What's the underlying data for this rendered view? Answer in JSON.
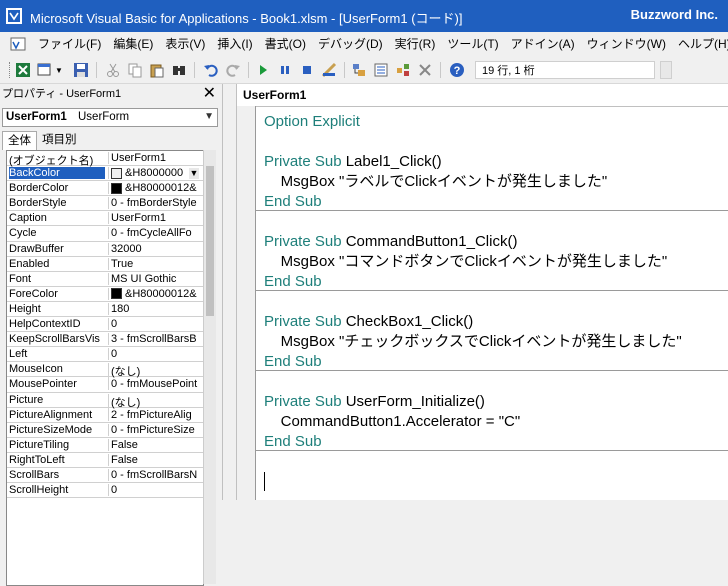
{
  "window": {
    "title": "Microsoft Visual Basic for Applications - Book1.xlsm - [UserForm1 (コード)]",
    "brand": "Buzzword Inc."
  },
  "menu": [
    "ファイル(F)",
    "編集(E)",
    "表示(V)",
    "挿入(I)",
    "書式(O)",
    "デバッグ(D)",
    "実行(R)",
    "ツール(T)",
    "アドイン(A)",
    "ウィンドウ(W)",
    "ヘルプ(H)"
  ],
  "toolbar": {
    "position": "19 行, 1 桁",
    "icons": [
      "excel-icon",
      "insert-userform-icon",
      "save-icon",
      "cut-icon",
      "copy-icon",
      "paste-icon",
      "find-icon",
      "undo-icon",
      "redo-icon",
      "run-icon",
      "break-icon",
      "reset-icon",
      "design-mode-icon",
      "project-explorer-icon",
      "properties-icon",
      "object-browser-icon",
      "toolbox-icon",
      "help-icon"
    ]
  },
  "properties": {
    "title": "プロパティ - UserForm1",
    "object_name": "UserForm1",
    "object_type": "UserForm",
    "tabs": [
      "全体",
      "項目別"
    ],
    "rows": [
      {
        "k": "(オブジェクト名)",
        "v": "UserForm1"
      },
      {
        "k": "BackColor",
        "v": "&H8000000",
        "swatch": "#f0f0f0",
        "selected": true,
        "dropdown": true
      },
      {
        "k": "BorderColor",
        "v": "&H80000012&",
        "swatch": "#000000"
      },
      {
        "k": "BorderStyle",
        "v": "0 - fmBorderStyle"
      },
      {
        "k": "Caption",
        "v": "UserForm1"
      },
      {
        "k": "Cycle",
        "v": "0 - fmCycleAllFo"
      },
      {
        "k": "DrawBuffer",
        "v": "32000"
      },
      {
        "k": "Enabled",
        "v": "True"
      },
      {
        "k": "Font",
        "v": "MS UI Gothic"
      },
      {
        "k": "ForeColor",
        "v": "&H80000012&",
        "swatch": "#000000"
      },
      {
        "k": "Height",
        "v": "180"
      },
      {
        "k": "HelpContextID",
        "v": "0"
      },
      {
        "k": "KeepScrollBarsVis",
        "v": "3 - fmScrollBarsB"
      },
      {
        "k": "Left",
        "v": "0"
      },
      {
        "k": "MouseIcon",
        "v": "(なし)"
      },
      {
        "k": "MousePointer",
        "v": "0 - fmMousePoint"
      },
      {
        "k": "Picture",
        "v": "(なし)"
      },
      {
        "k": "PictureAlignment",
        "v": "2 - fmPictureAlig"
      },
      {
        "k": "PictureSizeMode",
        "v": "0 - fmPictureSize"
      },
      {
        "k": "PictureTiling",
        "v": "False"
      },
      {
        "k": "RightToLeft",
        "v": "False"
      },
      {
        "k": "ScrollBars",
        "v": "0 - fmScrollBarsN"
      },
      {
        "k": "ScrollHeight",
        "v": "0"
      }
    ]
  },
  "code_window": {
    "title": "UserForm1",
    "lines": [
      {
        "kw": "Option Explicit",
        "rest": ""
      },
      {
        "kw": "",
        "rest": ""
      },
      {
        "kw": "Private Sub ",
        "rest": "Label1_Click()"
      },
      {
        "kw": "",
        "rest": "    MsgBox \"ラベルでClickイベントが発生しました\""
      },
      {
        "kw": "End Sub",
        "rest": ""
      },
      {
        "kw": "",
        "rest": ""
      },
      {
        "kw": "Private Sub ",
        "rest": "CommandButton1_Click()"
      },
      {
        "kw": "",
        "rest": "    MsgBox \"コマンドボタンでClickイベントが発生しました\""
      },
      {
        "kw": "End Sub",
        "rest": ""
      },
      {
        "kw": "",
        "rest": ""
      },
      {
        "kw": "Private Sub ",
        "rest": "CheckBox1_Click()"
      },
      {
        "kw": "",
        "rest": "    MsgBox \"チェックボックスでClickイベントが発生しました\""
      },
      {
        "kw": "End Sub",
        "rest": ""
      },
      {
        "kw": "",
        "rest": ""
      },
      {
        "kw": "Private Sub ",
        "rest": "UserForm_Initialize()"
      },
      {
        "kw": "",
        "rest": "    CommandButton1.Accelerator = \"C\""
      },
      {
        "kw": "End Sub",
        "rest": ""
      }
    ]
  },
  "colors": {
    "titlebar": "#1f5fbf",
    "keyword": "#1e7f7a"
  }
}
